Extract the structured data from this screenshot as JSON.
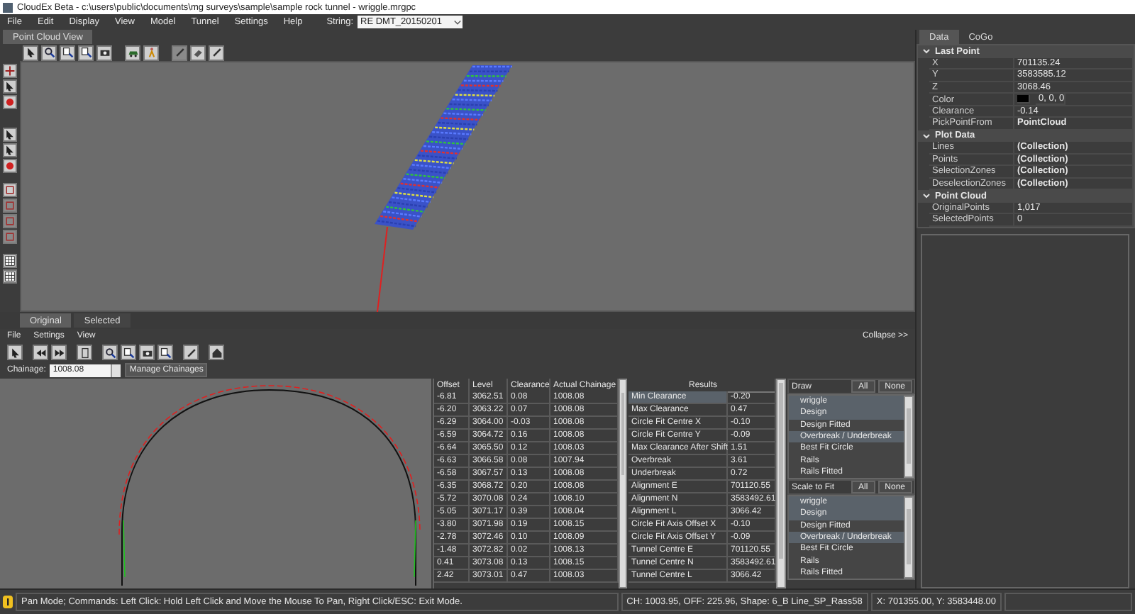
{
  "window": {
    "title": "CloudEx Beta - c:\\users\\public\\documents\\mg surveys\\sample\\sample rock tunnel - wriggle.mrgpc"
  },
  "menu": [
    "File",
    "Edit",
    "Display",
    "View",
    "Model",
    "Tunnel",
    "Settings",
    "Help"
  ],
  "string_selector": {
    "label": "String:",
    "value": "RE DMT_20150201"
  },
  "view_tabs": [
    {
      "label": "Point Cloud View",
      "selected": true
    }
  ],
  "bottom_tabs": [
    {
      "label": "Original",
      "selected": true
    },
    {
      "label": "Selected",
      "selected": false
    }
  ],
  "lower_panel": {
    "menu": [
      "File",
      "Settings",
      "View"
    ],
    "collapse_button": "Collapse >>",
    "chainage": {
      "label": "Chainage:",
      "value": "1008.08"
    },
    "manage_button": "Manage Chainages",
    "table": {
      "columns": [
        "Offset",
        "Level",
        "Clearance",
        "Actual Chainage"
      ],
      "rows": [
        [
          "-6.81",
          "3062.51",
          "0.08",
          "1008.08"
        ],
        [
          "-6.20",
          "3063.22",
          "0.07",
          "1008.08"
        ],
        [
          "-6.29",
          "3064.00",
          "-0.03",
          "1008.08"
        ],
        [
          "-6.59",
          "3064.72",
          "0.16",
          "1008.08"
        ],
        [
          "-6.64",
          "3065.50",
          "0.12",
          "1008.03"
        ],
        [
          "-6.63",
          "3066.58",
          "0.08",
          "1007.94"
        ],
        [
          "-6.58",
          "3067.57",
          "0.13",
          "1008.08"
        ],
        [
          "-6.35",
          "3068.72",
          "0.20",
          "1008.08"
        ],
        [
          "-5.72",
          "3070.08",
          "0.24",
          "1008.10"
        ],
        [
          "-5.05",
          "3071.17",
          "0.39",
          "1008.04"
        ],
        [
          "-3.80",
          "3071.98",
          "0.19",
          "1008.15"
        ],
        [
          "-2.78",
          "3072.46",
          "0.10",
          "1008.09"
        ],
        [
          "-1.48",
          "3072.82",
          "0.02",
          "1008.13"
        ],
        [
          "0.41",
          "3073.08",
          "0.13",
          "1008.15"
        ],
        [
          "2.42",
          "3073.01",
          "0.47",
          "1008.03"
        ]
      ]
    },
    "results": {
      "title": "Results",
      "rows": [
        {
          "label": "Min Clearance",
          "value": "-0.20",
          "selected": true
        },
        {
          "label": "Max Clearance",
          "value": "0.47",
          "selected": false
        },
        {
          "label": "Circle Fit Centre X",
          "value": "-0.10",
          "selected": false
        },
        {
          "label": "Circle Fit Centre Y",
          "value": "-0.09",
          "selected": false
        },
        {
          "label": "Max Clearance After Shift",
          "value": "1.51",
          "selected": false
        },
        {
          "label": "Overbreak",
          "value": "3.61",
          "selected": false
        },
        {
          "label": "Underbreak",
          "value": "0.72",
          "selected": false
        },
        {
          "label": "Alignment E",
          "value": "701120.55",
          "selected": false
        },
        {
          "label": "Alignment N",
          "value": "3583492.61",
          "selected": false
        },
        {
          "label": "Alignment L",
          "value": "3066.42",
          "selected": false
        },
        {
          "label": "Circle Fit Axis Offset X",
          "value": "-0.10",
          "selected": false
        },
        {
          "label": "Circle Fit Axis Offset Y",
          "value": "-0.09",
          "selected": false
        },
        {
          "label": "Tunnel Centre E",
          "value": "701120.55",
          "selected": false
        },
        {
          "label": "Tunnel Centre N",
          "value": "3583492.61",
          "selected": false
        },
        {
          "label": "Tunnel Centre L",
          "value": "3066.42",
          "selected": false
        }
      ]
    },
    "lists": [
      {
        "title": "Draw",
        "buttons": [
          "All",
          "None"
        ],
        "items": [
          {
            "label": "wriggle",
            "selected": true
          },
          {
            "label": "Design",
            "selected": true
          },
          {
            "label": "Design Fitted",
            "selected": false
          },
          {
            "label": "Overbreak / Underbreak",
            "selected": true
          },
          {
            "label": "Best Fit Circle",
            "selected": false
          },
          {
            "label": "Rails",
            "selected": false
          },
          {
            "label": "Rails Fitted",
            "selected": false
          }
        ]
      },
      {
        "title": "Scale to Fit",
        "buttons": [
          "All",
          "None"
        ],
        "items": [
          {
            "label": "wriggle",
            "selected": true
          },
          {
            "label": "Design",
            "selected": true
          },
          {
            "label": "Design Fitted",
            "selected": false
          },
          {
            "label": "Overbreak / Underbreak",
            "selected": true
          },
          {
            "label": "Best Fit Circle",
            "selected": false
          },
          {
            "label": "Rails",
            "selected": false
          },
          {
            "label": "Rails Fitted",
            "selected": false
          }
        ]
      }
    ]
  },
  "properties": {
    "tabs": [
      {
        "label": "Data",
        "selected": true
      },
      {
        "label": "CoGo",
        "selected": false
      }
    ],
    "categories": [
      {
        "name": "Last Point",
        "expanded": true,
        "items": [
          {
            "name": "X",
            "value": "701135.24",
            "bold": false
          },
          {
            "name": "Y",
            "value": "3583585.12",
            "bold": false
          },
          {
            "name": "Z",
            "value": "3068.46",
            "bold": false
          },
          {
            "name": "Color",
            "value": "0, 0, 0",
            "bold": false,
            "color": "#000000"
          },
          {
            "name": "Clearance",
            "value": "-0.14",
            "bold": false
          },
          {
            "name": "PickPointFrom",
            "value": "PointCloud",
            "bold": true
          }
        ]
      },
      {
        "name": "Plot Data",
        "expanded": true,
        "items": [
          {
            "name": "Lines",
            "value": "(Collection)",
            "bold": true
          },
          {
            "name": "Points",
            "value": "(Collection)",
            "bold": true
          },
          {
            "name": "SelectionZones",
            "value": "(Collection)",
            "bold": true
          },
          {
            "name": "DeselectionZones",
            "value": "(Collection)",
            "bold": true
          }
        ]
      },
      {
        "name": "Point Cloud",
        "expanded": true,
        "items": [
          {
            "name": "OriginalPoints",
            "value": "1,017",
            "bold": false
          },
          {
            "name": "SelectedPoints",
            "value": "0",
            "bold": false
          }
        ]
      }
    ]
  },
  "status_bar": {
    "message": "Pan Mode; Commands: Left Click: Hold Left Click and Move the Mouse To Pan, Right Click/ESC: Exit Mode.",
    "position": "CH: 1003.95, OFF: 225.96, Shape: 6_B Line_SP_Rass58",
    "coordinates": "X: 701355.00, Y: 3583448.00"
  }
}
